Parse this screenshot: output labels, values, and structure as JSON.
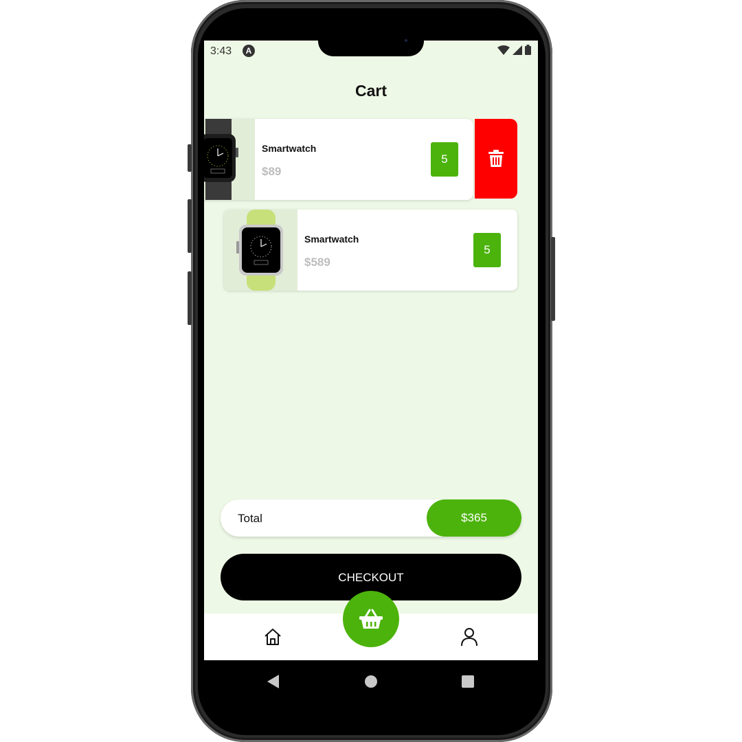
{
  "status_bar": {
    "time": "3:43",
    "badge": "A"
  },
  "header": {
    "title": "Cart"
  },
  "cart_items": [
    {
      "name": "Smartwatch",
      "price": "$89",
      "quantity": "5",
      "band_color": "#3a3a3a"
    },
    {
      "name": "Smartwatch",
      "price": "$589",
      "quantity": "5",
      "band_color": "#c8e07a"
    }
  ],
  "summary": {
    "total_label": "Total",
    "total_value": "$365"
  },
  "checkout": {
    "label": "CHECKOUT"
  },
  "bottom_nav": {
    "items": [
      "home-icon",
      "basket-icon",
      "user-icon"
    ]
  },
  "colors": {
    "accent": "#4cb30c",
    "danger": "#ff0000",
    "background": "#eef8e6"
  }
}
